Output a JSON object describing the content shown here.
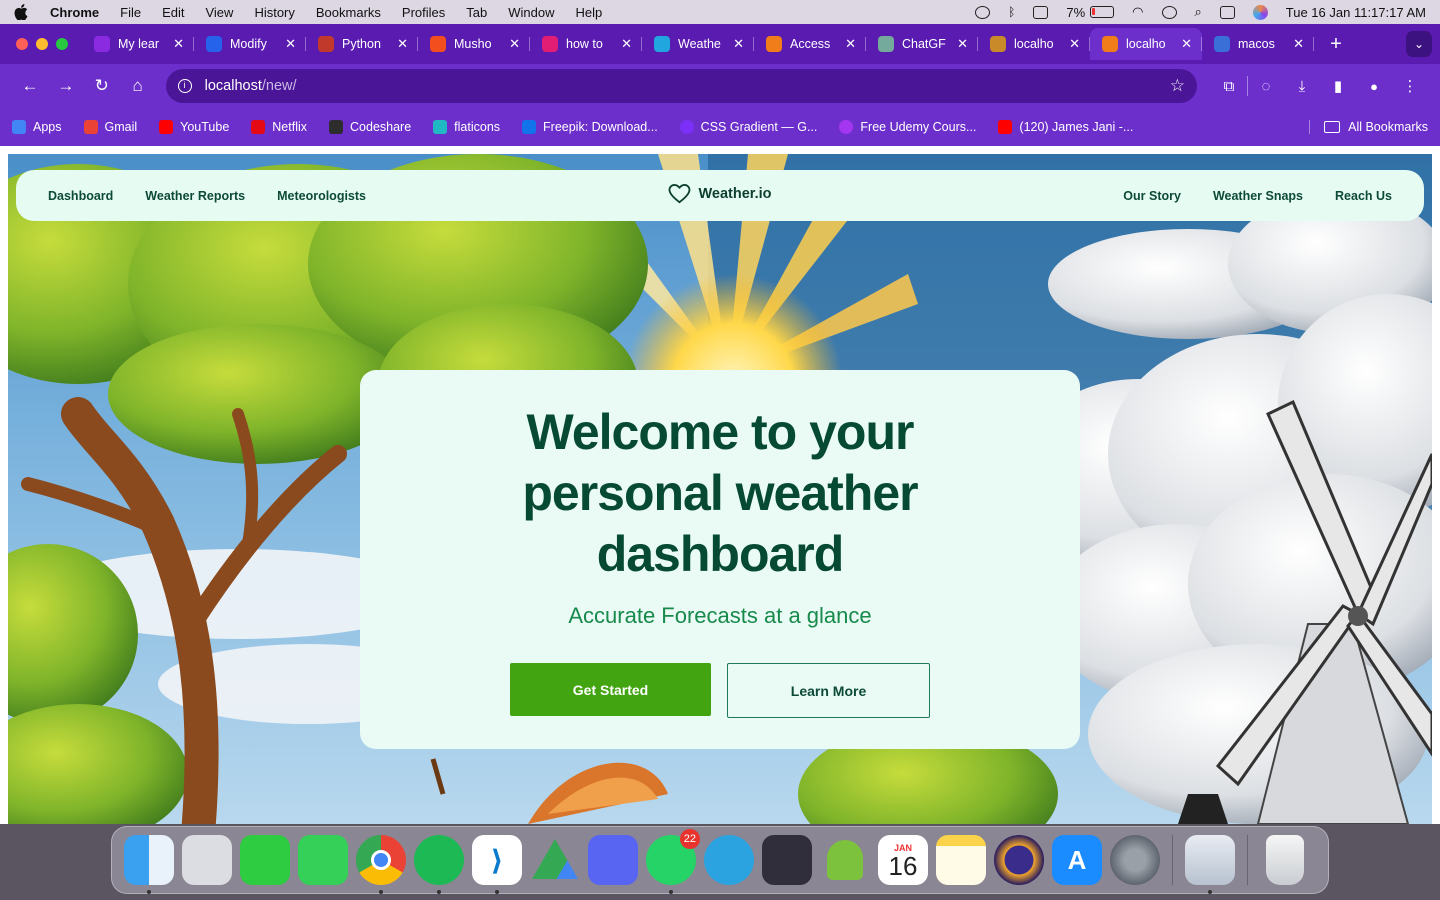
{
  "menubar": {
    "items": [
      "Chrome",
      "File",
      "Edit",
      "View",
      "History",
      "Bookmarks",
      "Profiles",
      "Tab",
      "Window",
      "Help"
    ],
    "battery": "7%",
    "datetime": "Tue 16 Jan  11:17:17 AM"
  },
  "tabs": [
    {
      "label": "My lear",
      "color": "#8a2be2"
    },
    {
      "label": "Modify",
      "color": "#2563eb"
    },
    {
      "label": "Python",
      "color": "#c0392b"
    },
    {
      "label": "Musho",
      "color": "#f24e1e"
    },
    {
      "label": "how to",
      "color": "#e11d74"
    },
    {
      "label": "Weathe",
      "color": "#22a6e0"
    },
    {
      "label": "Access",
      "color": "#f07c1a"
    },
    {
      "label": "ChatGF",
      "color": "#74aa9c"
    },
    {
      "label": "localho",
      "color": "#c98a2a"
    },
    {
      "label": "localho",
      "color": "#f07c1a"
    },
    {
      "label": "macos",
      "color": "#3b6fd8"
    }
  ],
  "address": {
    "host": "localhost",
    "path": "/new/"
  },
  "bookmarks": [
    {
      "label": "Apps",
      "color": "#4285f4"
    },
    {
      "label": "Gmail",
      "color": "#ea4335"
    },
    {
      "label": "YouTube",
      "color": "#ff0000"
    },
    {
      "label": "Netflix",
      "color": "#e50914"
    },
    {
      "label": "Codeshare",
      "color": "#2d2d2d"
    },
    {
      "label": "flaticons",
      "color": "#1fb8c3"
    },
    {
      "label": "Freepik: Download...",
      "color": "#1273eb"
    },
    {
      "label": "CSS Gradient — G...",
      "color": "#7b2ff7"
    },
    {
      "label": "Free Udemy Cours...",
      "color": "#a435f0"
    },
    {
      "label": "(120) James Jani -...",
      "color": "#ff0000"
    }
  ],
  "bookmarks_right": "All Bookmarks",
  "site": {
    "nav_left": [
      "Dashboard",
      "Weather Reports",
      "Meteorologists"
    ],
    "brand": "Weather.io",
    "nav_right": [
      "Our Story",
      "Weather Snaps",
      "Reach Us"
    ]
  },
  "hero": {
    "title_line1": "Welcome to your",
    "title_line2": "personal weather",
    "title_line3": "dashboard",
    "subtitle": "Accurate Forecasts at a glance",
    "primary_button": "Get Started",
    "secondary_button": "Learn More"
  },
  "dock": {
    "whatsapp_badge": "22",
    "calendar_month": "JAN",
    "calendar_day": "16"
  },
  "colors": {
    "chrome_frame": "#5a1bb0",
    "nav_bg": "#e6fbf2",
    "card_bg": "#e9fbf4",
    "title_green": "#074a33",
    "subtitle_green": "#178a4c",
    "button_green": "#42a410"
  }
}
